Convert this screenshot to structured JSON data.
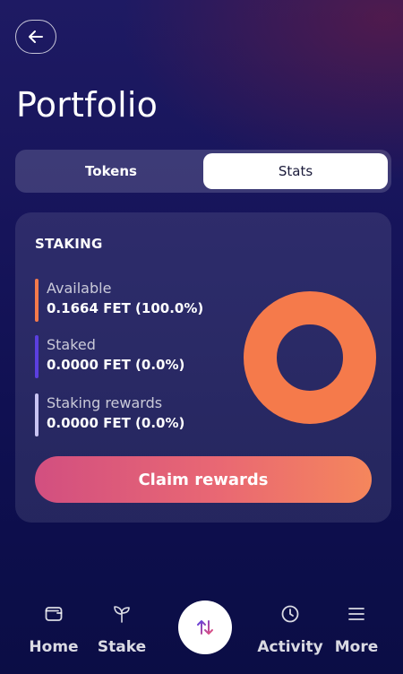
{
  "header": {
    "title": "Portfolio"
  },
  "tabs": [
    {
      "label": "Tokens",
      "active": false
    },
    {
      "label": "Stats",
      "active": true
    }
  ],
  "staking": {
    "title": "STAKING",
    "items": [
      {
        "label": "Available",
        "value": "0.1664 FET (100.0%)",
        "color": "#f57a4b",
        "fraction": 1.0
      },
      {
        "label": "Staked",
        "value": "0.0000 FET (0.0%)",
        "color": "#5b3fe0",
        "fraction": 0.0
      },
      {
        "label": "Staking rewards",
        "value": "0.0000 FET (0.0%)",
        "color": "#c9c4f2",
        "fraction": 0.0
      }
    ],
    "claim_label": "Claim rewards"
  },
  "nav": {
    "items": [
      {
        "label": "Home",
        "icon": "wallet-icon"
      },
      {
        "label": "Stake",
        "icon": "sprout-icon"
      },
      {
        "label": "",
        "icon": "swap-arrows-icon"
      },
      {
        "label": "Activity",
        "icon": "clock-icon"
      },
      {
        "label": "More",
        "icon": "menu-icon"
      }
    ]
  }
}
